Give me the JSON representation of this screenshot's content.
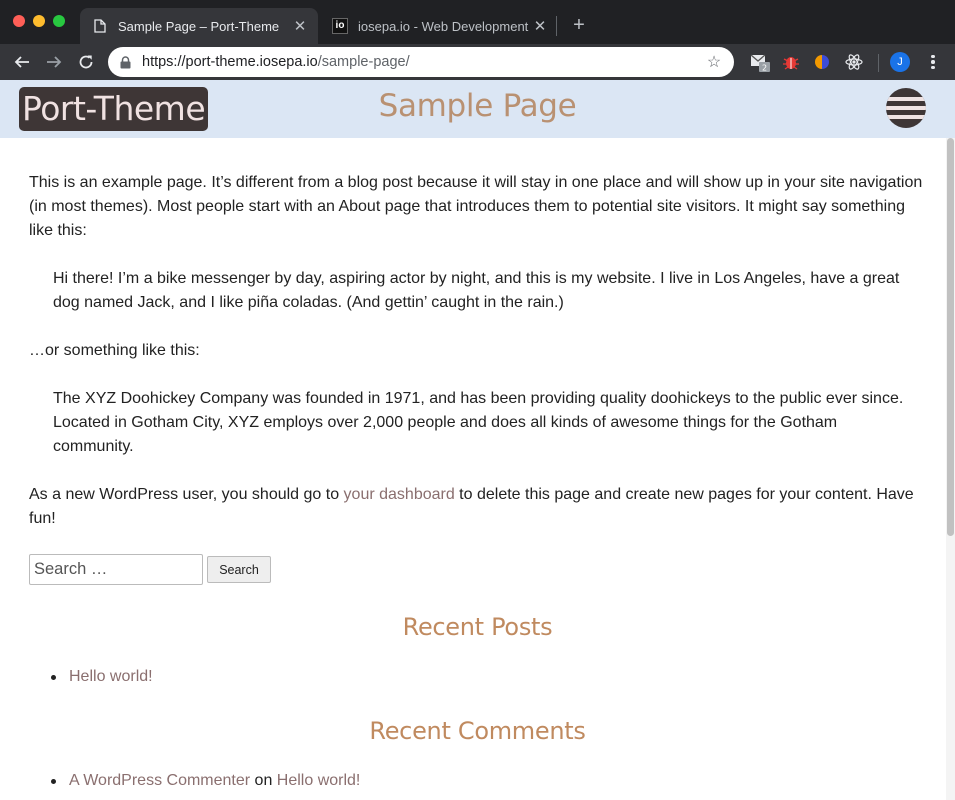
{
  "browser": {
    "tabs": [
      {
        "title": "Sample Page – Port-Theme",
        "active": true
      },
      {
        "title": "iosepa.io - Web Development",
        "active": false,
        "favicon_text": "io"
      }
    ],
    "url": {
      "host": "https://port-theme.iosepa.io",
      "path": "/sample-page/"
    },
    "extension_badge": "2",
    "profile_initial": "J",
    "colors": {
      "tabbar": "#202124",
      "toolbar": "#35363a",
      "profile": "#1a73e8"
    }
  },
  "site": {
    "logo": "Port-Theme",
    "page_title": "Sample Page",
    "colors": {
      "header_bg": "#dbe6f4",
      "logo_bg": "#3e3636",
      "title": "#b99172",
      "widget_title": "#c08a5f",
      "link": "#8a6f6f"
    }
  },
  "content": {
    "intro": "This is an example page. It’s different from a blog post because it will stay in one place and will show up in your site navigation (in most themes). Most people start with an About page that introduces them to potential site visitors. It might say something like this:",
    "quote1": "Hi there! I’m a bike messenger by day, aspiring actor by night, and this is my website. I live in Los Angeles, have a great dog named Jack, and I like piña coladas. (And gettin’ caught in the rain.)",
    "middle": "…or something like this:",
    "quote2": "The XYZ Doohickey Company was founded in 1971, and has been providing quality doohickeys to the public ever since. Located in Gotham City, XYZ employs over 2,000 people and does all kinds of awesome things for the Gotham community.",
    "outro_before": "As a new WordPress user, you should go to ",
    "outro_link": "your dashboard",
    "outro_after": " to delete this page and create new pages for your content. Have fun!"
  },
  "search": {
    "placeholder": "Search …",
    "button": "Search"
  },
  "recent_posts": {
    "title": "Recent Posts",
    "items": [
      "Hello world!"
    ]
  },
  "recent_comments": {
    "title": "Recent Comments",
    "author": "A WordPress Commenter",
    "connector": " on ",
    "post": "Hello world!"
  }
}
